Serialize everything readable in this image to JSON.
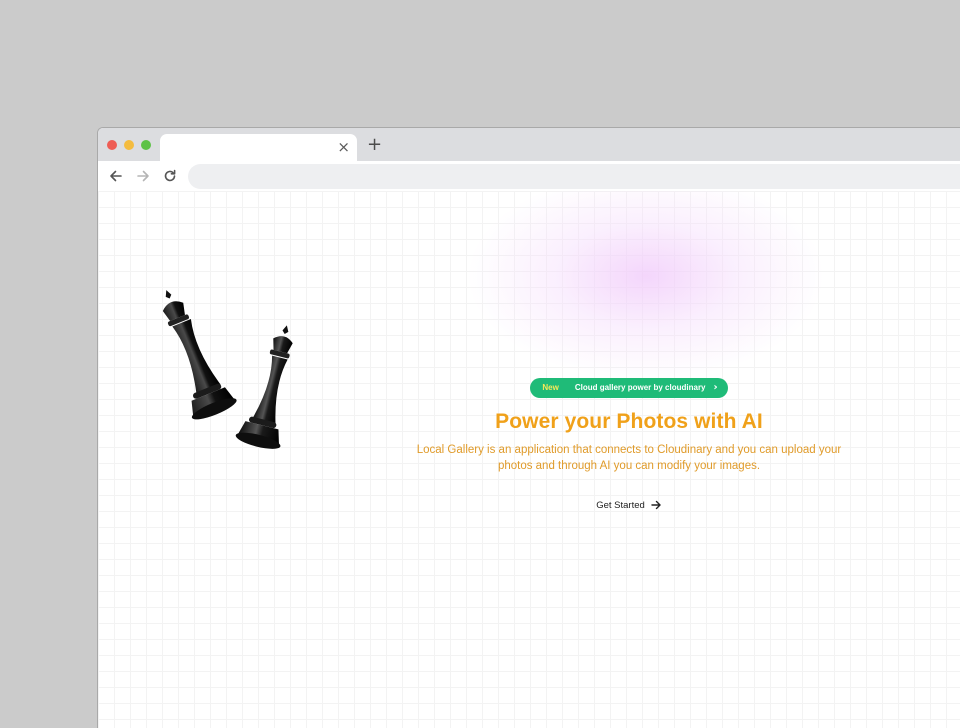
{
  "browser": {
    "tab_close_glyph": "×",
    "new_tab_glyph": "+",
    "address_value": ""
  },
  "hero": {
    "badge_tag": "New",
    "badge_text": "Cloud gallery power by cloudinary",
    "badge_chevron": "›",
    "title": "Power your Photos with AI",
    "description": "Local Gallery is an application that connects to Cloudinary and you can upload your photos and through AI you can modify your images.",
    "cta_label": "Get Started"
  },
  "icons": {
    "back": "arrow-left-icon",
    "forward": "arrow-right-icon",
    "reload": "reload-icon",
    "cta": "arrow-right-icon",
    "hero_image": "chess-kings-image"
  },
  "colors": {
    "accent": "#f0a11a",
    "badge": "#1fbb78",
    "badge_tag": "#f7e85a"
  }
}
